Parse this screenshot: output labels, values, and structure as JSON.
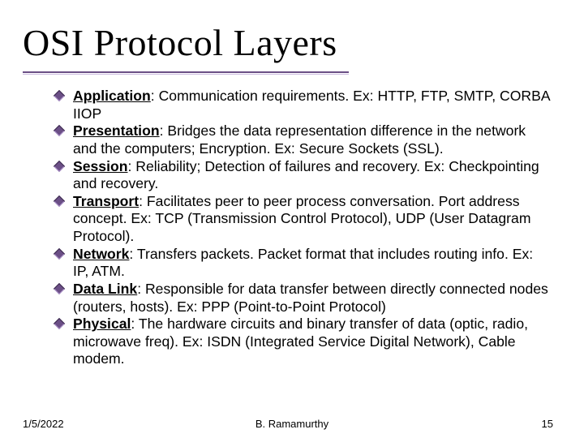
{
  "title": "OSI Protocol Layers",
  "items": [
    {
      "term": "Application",
      "text": ": Communication requirements. Ex: HTTP, FTP, SMTP, CORBA IIOP"
    },
    {
      "term": "Presentation",
      "text": ": Bridges the data representation difference in the network and the computers; Encryption. Ex: Secure Sockets (SSL)."
    },
    {
      "term": "Session",
      "text": ": Reliability; Detection of failures and recovery. Ex: Checkpointing and recovery."
    },
    {
      "term": "Transport",
      "text": ": Facilitates peer to peer process conversation. Port address concept. Ex: TCP (Transmission Control Protocol), UDP (User Datagram Protocol)."
    },
    {
      "term": "Network",
      "text": ": Transfers packets. Packet format that includes routing info. Ex: IP, ATM."
    },
    {
      "term": "Data Link",
      "text": ": Responsible for data transfer between directly connected nodes (routers, hosts). Ex: PPP (Point-to-Point Protocol)"
    },
    {
      "term": "Physical",
      "text": ": The hardware circuits and binary transfer of data (optic, radio, microwave freq). Ex: ISDN (Integrated Service Digital Network), Cable modem."
    }
  ],
  "footer": {
    "date": "1/5/2022",
    "author": "B. Ramamurthy",
    "page": "15"
  }
}
